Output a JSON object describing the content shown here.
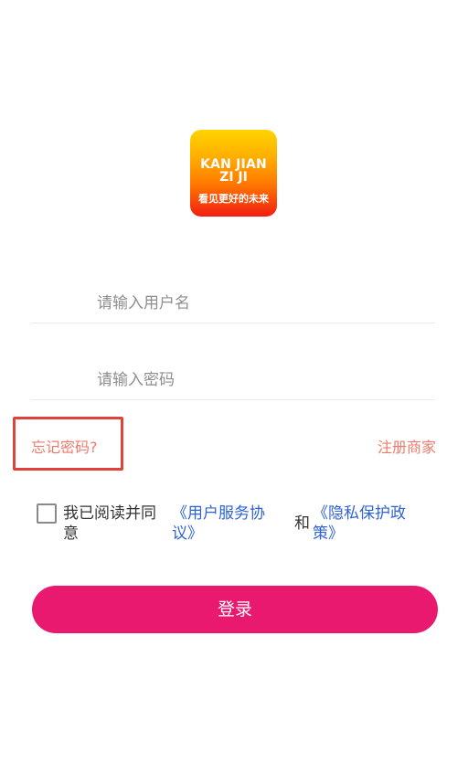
{
  "logo": {
    "line1": "KAN JIAN",
    "line2": "ZI JI",
    "slogan": "看见更好的未来"
  },
  "form": {
    "username_placeholder": "请输入用户名",
    "password_placeholder": "请输入密码"
  },
  "links": {
    "forgot_password": "忘记密码?",
    "register_merchant": "注册商家"
  },
  "agreement": {
    "prefix": "我已阅读并同意",
    "user_agreement": "《用户服务协议》",
    "and": "和",
    "privacy_policy": "《隐私保护政策》",
    "checked": false
  },
  "login_button": "登录",
  "colors": {
    "accent": "#e8196f",
    "link_orange": "#f17a6b",
    "link_blue": "#2f63d6",
    "highlight_box": "#e0423a"
  }
}
